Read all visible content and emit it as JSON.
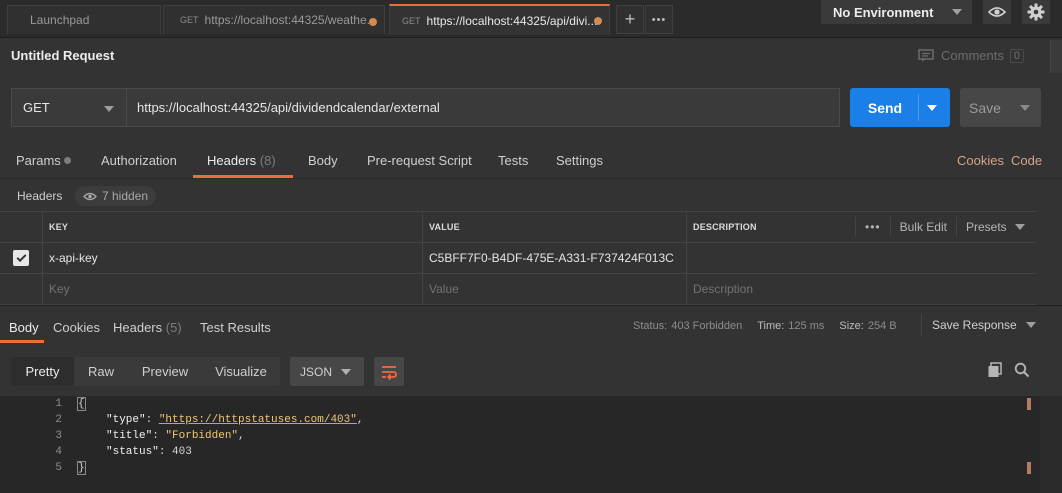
{
  "tabs": [
    {
      "method": "",
      "label": "Launchpad",
      "active": false,
      "unsaved": false
    },
    {
      "method": "GET",
      "label": "https://localhost:44325/weathe...",
      "active": false,
      "unsaved": true
    },
    {
      "method": "GET",
      "label": "https://localhost:44325/api/divi...",
      "active": true,
      "unsaved": true
    }
  ],
  "tabbar": {
    "new_tab_icon": "+",
    "more_icon": "•••"
  },
  "environment": {
    "selected": "No Environment"
  },
  "request": {
    "title": "Untitled Request",
    "method": "GET",
    "url": "https://localhost:44325/api/dividendcalendar/external",
    "send_label": "Send",
    "save_label": "Save"
  },
  "comments": {
    "label": "Comments",
    "count": "0"
  },
  "request_tabs": [
    {
      "label": "Params",
      "badge": ""
    },
    {
      "label": "Authorization",
      "badge": ""
    },
    {
      "label": "Headers",
      "badge": "(8)"
    },
    {
      "label": "Body",
      "badge": ""
    },
    {
      "label": "Pre-request Script",
      "badge": ""
    },
    {
      "label": "Tests",
      "badge": ""
    },
    {
      "label": "Settings",
      "badge": ""
    }
  ],
  "request_tabs_right": {
    "cookies": "Cookies",
    "code": "Code"
  },
  "headers_section": {
    "label": "Headers",
    "hidden_label": "7 hidden"
  },
  "headers_table": {
    "columns": [
      "KEY",
      "VALUE",
      "DESCRIPTION"
    ],
    "tools": {
      "more": "•••",
      "bulk_edit": "Bulk Edit",
      "presets": "Presets"
    },
    "rows": [
      {
        "checked": true,
        "key": "x-api-key",
        "value": "C5BFF7F0-B4DF-475E-A331-F737424F013C",
        "description": ""
      }
    ],
    "placeholders": {
      "key": "Key",
      "value": "Value",
      "description": "Description"
    }
  },
  "response": {
    "tabs": [
      {
        "label": "Body",
        "badge": ""
      },
      {
        "label": "Cookies",
        "badge": ""
      },
      {
        "label": "Headers",
        "badge": "(5)"
      },
      {
        "label": "Test Results",
        "badge": ""
      }
    ],
    "status_label": "Status:",
    "status_value": "403 Forbidden",
    "time_label": "Time:",
    "time_value": "125 ms",
    "size_label": "Size:",
    "size_value": "254 B",
    "save_label": "Save Response"
  },
  "view": {
    "modes": [
      "Pretty",
      "Raw",
      "Preview",
      "Visualize"
    ],
    "active_mode": "Pretty",
    "format": "JSON"
  },
  "code": {
    "line_numbers": [
      "1",
      "2",
      "3",
      "4",
      "5"
    ],
    "open_brace": "{",
    "close_brace": "}",
    "type_key": "\"type\"",
    "type_value": "\"https://httpstatuses.com/403\"",
    "title_key": "\"title\"",
    "title_value": "\"Forbidden\"",
    "status_key": "\"status\"",
    "status_value": "403"
  },
  "colors": {
    "accent": "#f26b3a",
    "send": "#1a7fe6",
    "background": "#333333"
  }
}
